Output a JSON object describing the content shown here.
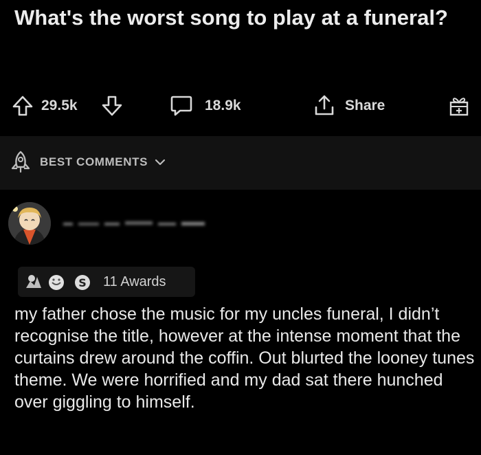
{
  "post": {
    "title": "What's the worst song to play at a funeral?"
  },
  "actions": {
    "upvotes": "29.5k",
    "comments": "18.9k",
    "share_label": "Share"
  },
  "sort": {
    "label": "BEST COMMENTS"
  },
  "comment": {
    "awards_label": "11 Awards",
    "body": "my father chose the music for my uncles funeral, I didn’t recognise the title, however at the intense moment that the curtains drew around the coffin. Out blurted the looney tunes theme. We were horrified and my dad sat there hunched over giggling to himself."
  },
  "colors": {
    "background": "#000000",
    "sort_bar": "#121212",
    "text": "#e6e6e6"
  }
}
